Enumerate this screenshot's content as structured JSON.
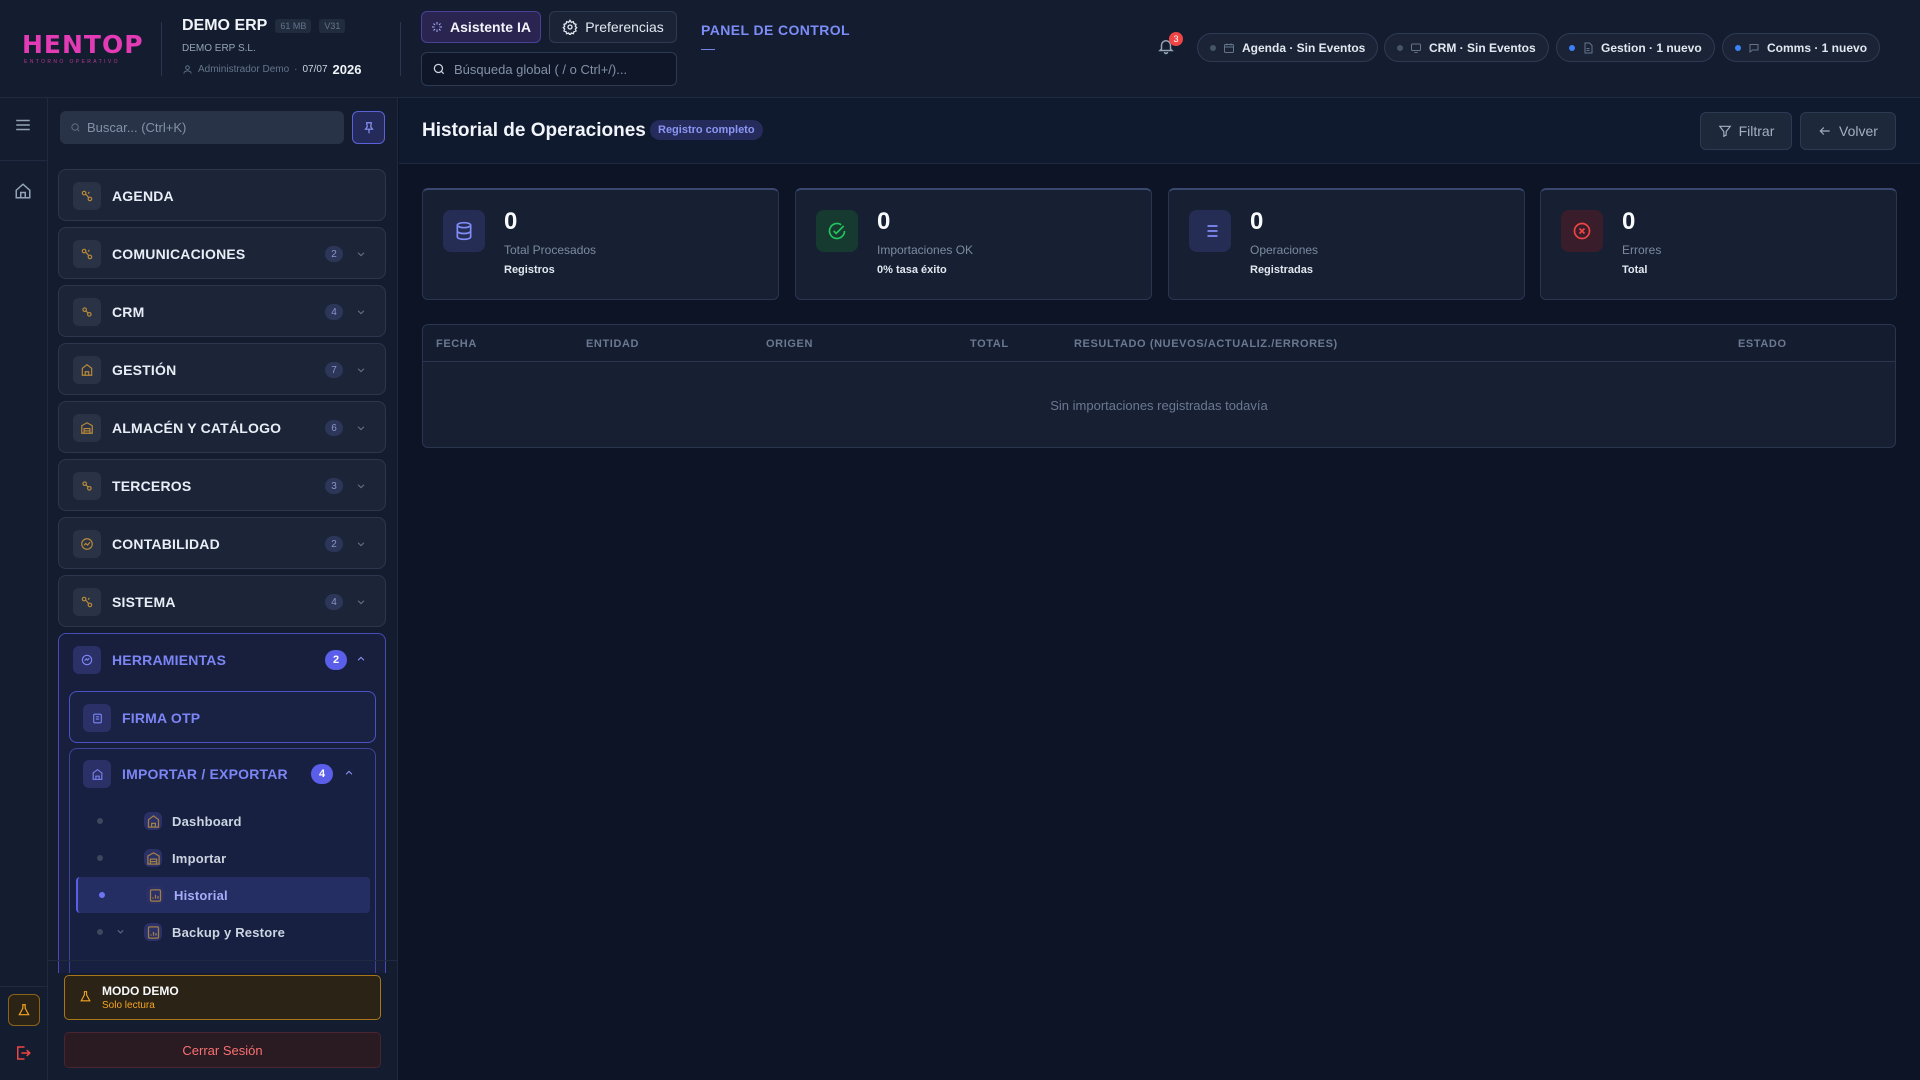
{
  "header": {
    "logo_text": "HENTOP",
    "logo_subtitle": "ENTORNO OPERATIVO",
    "company_name": "DEMO ERP",
    "chip_mem": "61 MB",
    "chip_version": "V31",
    "company_legal": "DEMO ERP S.L.",
    "user": "Administrador Demo",
    "separator": "·",
    "date": "07/07",
    "year": "2026",
    "ai_button": "Asistente IA",
    "prefs_button": "Preferencias",
    "search_placeholder": "Búsqueda global ( / o Ctrl+/)...",
    "panel_title": "PANEL DE CONTROL",
    "panel_dash": "—",
    "notif_count": "3",
    "pills": [
      {
        "label": "Agenda · Sin Eventos",
        "dot": "#475569"
      },
      {
        "label": "CRM · Sin Eventos",
        "dot": "#475569"
      },
      {
        "label": "Gestion · 1 nuevo",
        "dot": "#3b82f6"
      },
      {
        "label": "Comms · 1 nuevo",
        "dot": "#3b82f6"
      }
    ]
  },
  "sidebar": {
    "search_placeholder": "Buscar... (Ctrl+K)",
    "sections": [
      {
        "label": "AGENDA",
        "count": ""
      },
      {
        "label": "COMUNICACIONES",
        "count": "2"
      },
      {
        "label": "CRM",
        "count": "4"
      },
      {
        "label": "GESTIÓN",
        "count": "7"
      },
      {
        "label": "ALMACÉN Y CATÁLOGO",
        "count": "6"
      },
      {
        "label": "TERCEROS",
        "count": "3"
      },
      {
        "label": "CONTABILIDAD",
        "count": "2"
      },
      {
        "label": "SISTEMA",
        "count": "4"
      }
    ],
    "herramientas": {
      "label": "HERRAMIENTAS",
      "count": "2",
      "firma": "FIRMA OTP",
      "impexp": {
        "label": "IMPORTAR / EXPORTAR",
        "count": "4",
        "items": [
          "Dashboard",
          "Importar",
          "Historial",
          "Backup y Restore"
        ]
      }
    },
    "demo_title": "MODO DEMO",
    "demo_subtitle": "Solo lectura",
    "logout": "Cerrar Sesión"
  },
  "main": {
    "title": "Historial de Operaciones",
    "badge": "Registro completo",
    "filter_button": "Filtrar",
    "back_button": "Volver",
    "stats": [
      {
        "value": "0",
        "label": "Total Procesados",
        "sub": "Registros",
        "icon": "database-icon",
        "color": "#818cf8",
        "bg": "#252d55"
      },
      {
        "value": "0",
        "label": "Importaciones OK",
        "sub": "0% tasa éxito",
        "icon": "check-circle-icon",
        "color": "#22c55e",
        "bg": "#163a30"
      },
      {
        "value": "0",
        "label": "Operaciones",
        "sub": "Registradas",
        "icon": "list-icon",
        "color": "#818cf8",
        "bg": "#252d55"
      },
      {
        "value": "0",
        "label": "Errores",
        "sub": "Total",
        "icon": "x-circle-icon",
        "color": "#ef4444",
        "bg": "#3a1d2a"
      }
    ],
    "table": {
      "columns": [
        "FECHA",
        "ENTIDAD",
        "ORIGEN",
        "TOTAL",
        "RESULTADO (NUEVOS/ACTUALIZ./ERRORES)",
        "ESTADO"
      ],
      "empty": "Sin importaciones registradas todavía"
    }
  }
}
